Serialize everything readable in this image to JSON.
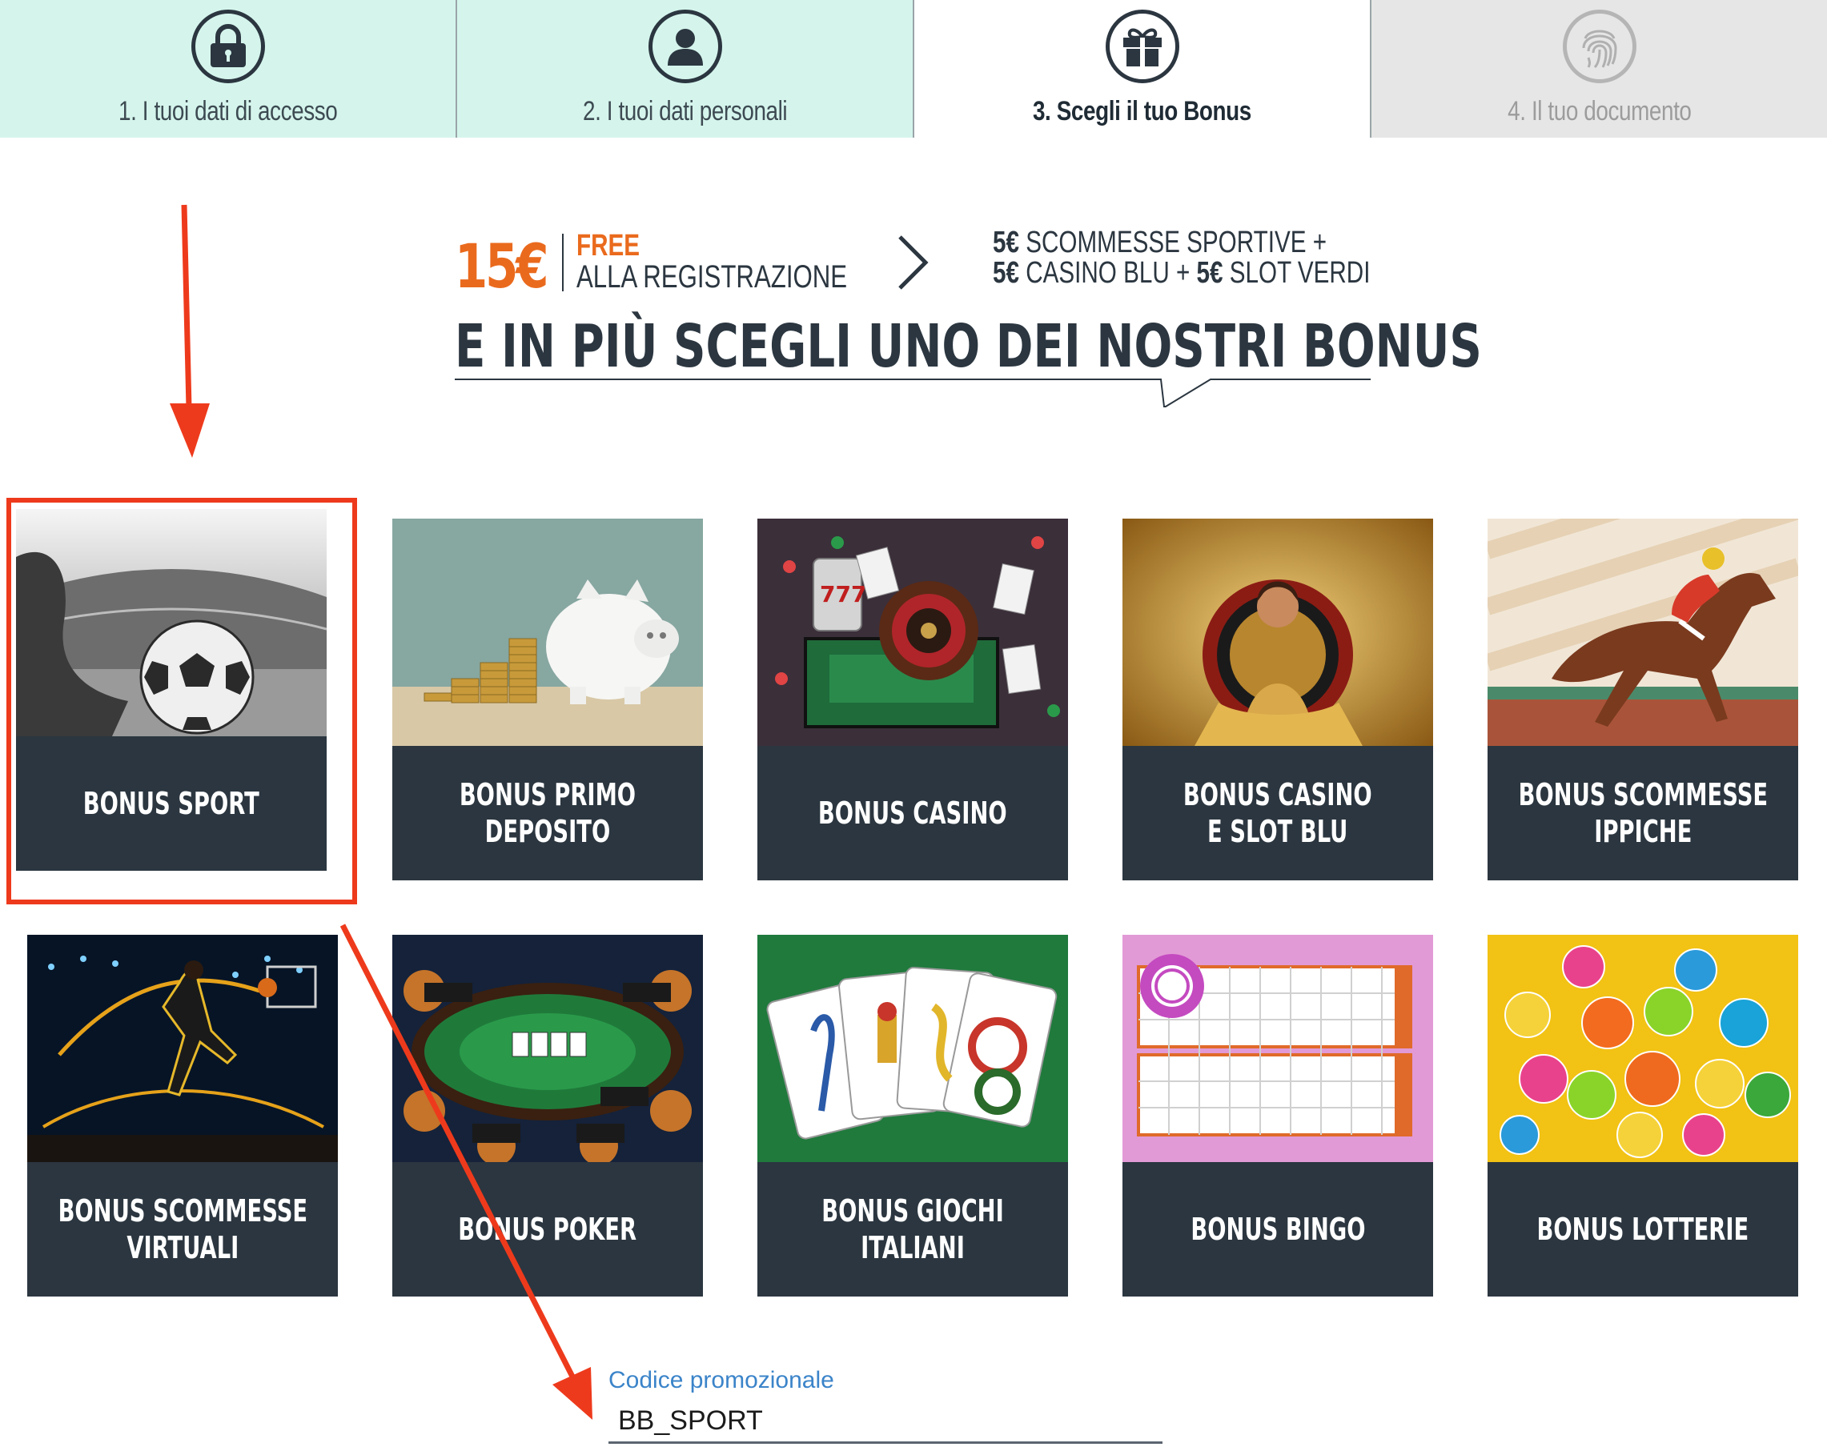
{
  "steps": [
    {
      "number": "1.",
      "label": "I tuoi dati di accesso",
      "icon": "lock-icon",
      "state": "done"
    },
    {
      "number": "2.",
      "label": "I tuoi dati personali",
      "icon": "user-icon",
      "state": "done"
    },
    {
      "number": "3.",
      "label": "Scegli il tuo Bonus",
      "icon": "gift-icon",
      "state": "active"
    },
    {
      "number": "4.",
      "label": "Il tuo documento",
      "icon": "fingerprint-icon",
      "state": "todo"
    }
  ],
  "promo": {
    "amount": "15€",
    "free": "FREE",
    "registration": "ALLA REGISTRAZIONE",
    "split_line1_amount": "5€",
    "split_line1_text": "SCOMMESSE SPORTIVE +",
    "split_line2_amount1": "5€",
    "split_line2_text1": "CASINO BLU +",
    "split_line2_amount2": "5€",
    "split_line2_text2": "SLOT VERDI",
    "headline": "E IN PIÙ SCEGLI UNO DEI NOSTRI BONUS"
  },
  "bonuses": [
    {
      "line1": "BONUS SPORT",
      "line2": "",
      "selected": true
    },
    {
      "line1": "BONUS PRIMO",
      "line2": "DEPOSITO",
      "selected": false
    },
    {
      "line1": "BONUS CASINO",
      "line2": "",
      "selected": false
    },
    {
      "line1": "BONUS CASINO",
      "line2": "E SLOT BLU",
      "selected": false
    },
    {
      "line1": "BONUS SCOMMESSE",
      "line2": "IPPICHE",
      "selected": false
    },
    {
      "line1": "BONUS SCOMMESSE",
      "line2": "VIRTUALI",
      "selected": false
    },
    {
      "line1": "BONUS POKER",
      "line2": "",
      "selected": false
    },
    {
      "line1": "BONUS GIOCHI",
      "line2": "ITALIANI",
      "selected": false
    },
    {
      "line1": "BONUS BINGO",
      "line2": "",
      "selected": false
    },
    {
      "line1": "BONUS LOTTERIE",
      "line2": "",
      "selected": false
    }
  ],
  "promo_code": {
    "label": "Codice promozionale",
    "value": "BB_SPORT"
  },
  "colors": {
    "accent_orange": "#ea6a1d",
    "dark_navy": "#2b3640",
    "step_done_bg": "#d5f5ec",
    "annotation_red": "#ee3a1c",
    "link_blue": "#3b84c9"
  }
}
